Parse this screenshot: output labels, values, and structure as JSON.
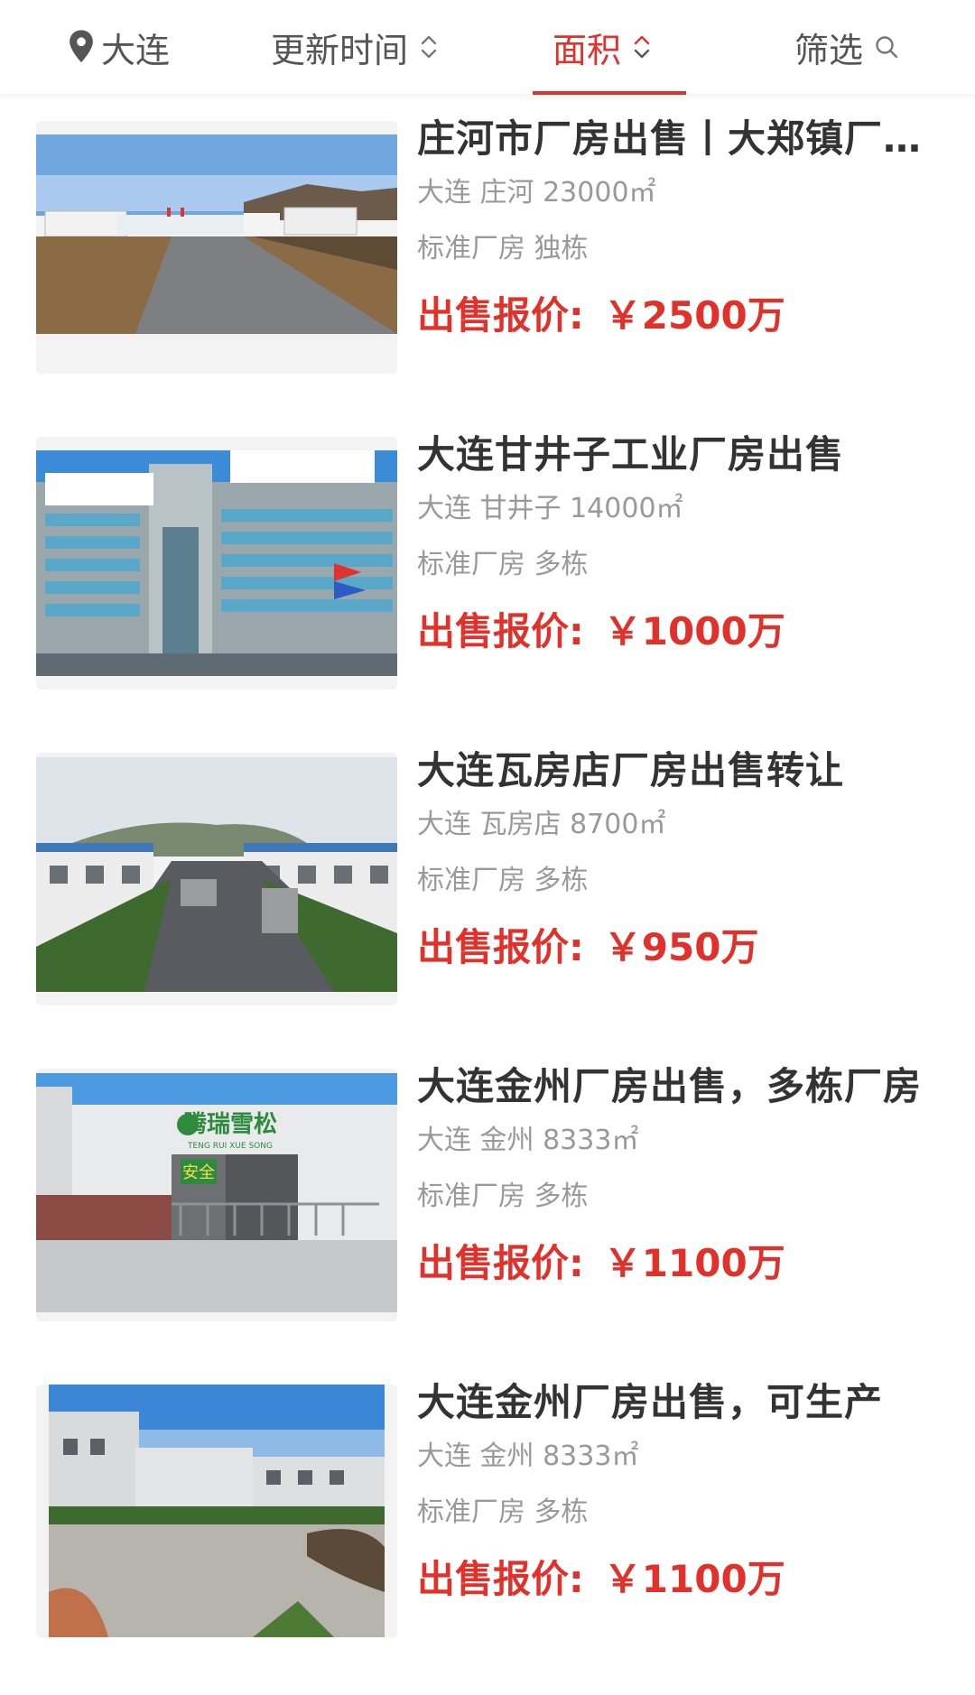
{
  "topbar": {
    "city": "大连",
    "update_time": "更新时间",
    "area": "面积",
    "filter": "筛选"
  },
  "colors": {
    "accent": "#e0312a",
    "text": "#333333",
    "muted": "#999999"
  },
  "listings": [
    {
      "title": "庄河市厂房出售丨大郑镇厂房出售",
      "city": "大连",
      "district": "庄河",
      "area": "23000㎡",
      "tags": "标准厂房 独栋",
      "price_label": "出售报价:",
      "price": "￥2500万",
      "photo": "factory-yard-photo"
    },
    {
      "title": "大连甘井子工业厂房出售",
      "city": "大连",
      "district": "甘井子",
      "area": "14000㎡",
      "tags": "标准厂房 多栋",
      "price_label": "出售报价:",
      "price": "￥1000万",
      "photo": "office-building-photo"
    },
    {
      "title": "大连瓦房店厂房出售转让",
      "city": "大连",
      "district": "瓦房店",
      "area": "8700㎡",
      "tags": "标准厂房 多栋",
      "price_label": "出售报价:",
      "price": "￥950万",
      "photo": "factory-road-photo"
    },
    {
      "title": "大连金州厂房出售，多栋厂房",
      "city": "大连",
      "district": "金州",
      "area": "8333㎡",
      "tags": "标准厂房 多栋",
      "price_label": "出售报价:",
      "price": "￥1100万",
      "photo": "factory-gate-photo",
      "sign_cn": "腾瑞雪松",
      "sign_en": "TENG RUI XUE SONG",
      "banner": "安全"
    },
    {
      "title": "大连金州厂房出售，可生产",
      "city": "大连",
      "district": "金州",
      "area": "8333㎡",
      "tags": "标准厂房 多栋",
      "price_label": "出售报价:",
      "price": "￥1100万",
      "photo": "factory-lot-photo"
    }
  ]
}
